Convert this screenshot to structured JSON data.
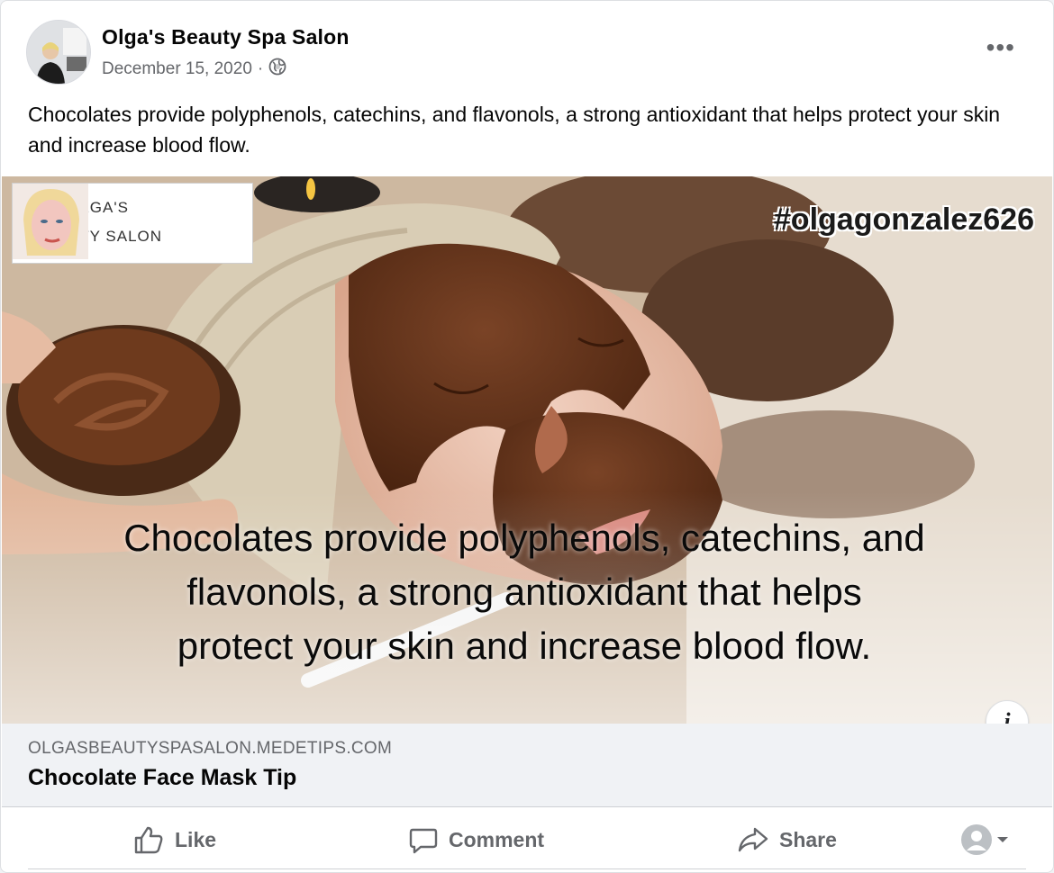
{
  "post": {
    "page_name": "Olga's Beauty Spa Salon",
    "date": "December 15, 2020",
    "separator": "·",
    "audience_icon": "globe-icon",
    "more_label": "•••",
    "caption": "Chocolates provide polyphenols, catechins, and flavonols, a strong antioxidant that helps protect your skin and increase blood flow."
  },
  "image": {
    "logo_line1": "OLGA'S",
    "logo_line2": "BEAUTY SALON",
    "hashtag": "#olgagonzalez626",
    "overlay_line1": "Chocolates provide polyphenols, catechins, and",
    "overlay_line2": "flavonols, a strong antioxidant that helps",
    "overlay_line3": "protect your skin and increase blood flow.",
    "info_label": "i"
  },
  "link": {
    "domain": "OLGASBEAUTYSPASALON.MEDETIPS.COM",
    "title": "Chocolate Face Mask Tip"
  },
  "actions": {
    "like": "Like",
    "comment": "Comment",
    "share": "Share"
  },
  "colors": {
    "text_primary": "#050505",
    "text_secondary": "#65676b",
    "link_bg": "#f0f2f5",
    "chocolate": "#5a2f16"
  }
}
